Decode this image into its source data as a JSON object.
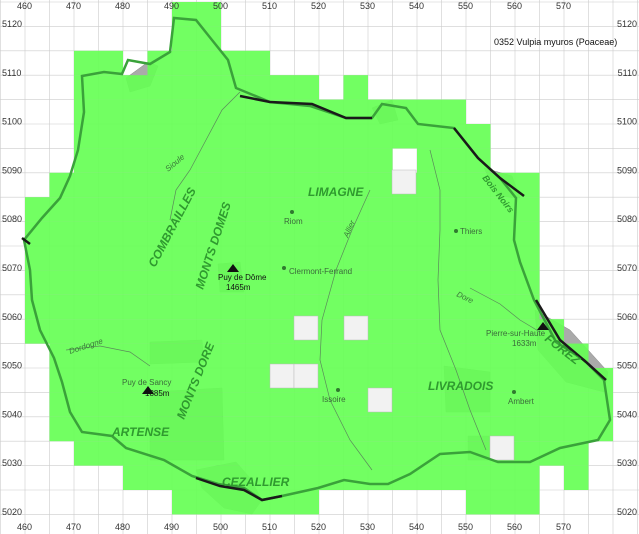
{
  "title": "0352 Vulpia myuros (Poaceae)",
  "x_ticks": [
    "460",
    "470",
    "480",
    "490",
    "500",
    "510",
    "520",
    "530",
    "540",
    "550",
    "560",
    "570"
  ],
  "y_ticks": [
    "5120",
    "5110",
    "5100",
    "5090",
    "5080",
    "5070",
    "5060",
    "5050",
    "5040",
    "5030",
    "5020"
  ],
  "regions": {
    "combrailles": "COMBRAILLES",
    "limagne": "LIMAGNE",
    "monts_domes": "MONTS DOMES",
    "monts_dore": "MONTS DORE",
    "livradois": "LIVRADOIS",
    "artense": "ARTENSE",
    "cezallier": "CEZALLIER",
    "forez": "FOREZ",
    "bois_noirs": "Bois Noirs"
  },
  "places": {
    "riom": "Riom",
    "thiers": "Thiers",
    "clermont": "Clermont-Ferrand",
    "puy_dome": "Puy de Dôme",
    "puy_dome_alt": "1465m",
    "issoire": "Issoire",
    "ambert": "Ambert",
    "puy_sancy": "Puy de Sancy",
    "puy_sancy_alt": "1885m",
    "pierre": "Pierre-sur-Haute",
    "pierre_alt": "1633m"
  },
  "rivers": {
    "sioule": "Sioule",
    "allier": "Allier",
    "dore": "Dore",
    "dordogne": "Dordogne"
  },
  "colors": {
    "presence": "#66ff55",
    "relief": "#aaaaaa",
    "grid": "#cccccc",
    "border": "#1a1a1a",
    "region_border": "#3aa23a",
    "label_green": "#2f9a2f"
  }
}
